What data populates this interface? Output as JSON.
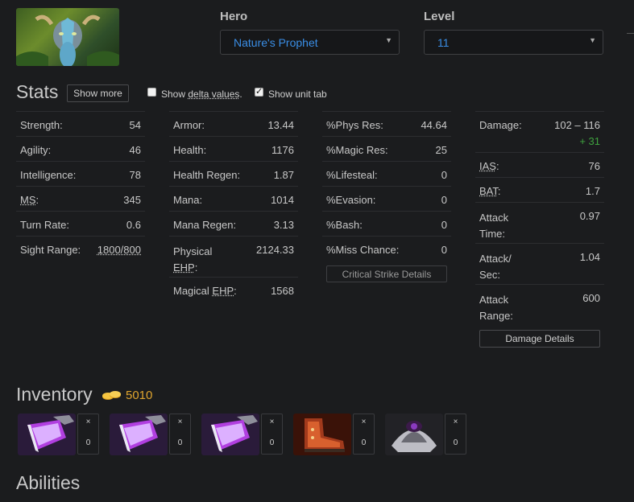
{
  "hero_label": "Hero",
  "hero_value": "Nature's Prophet",
  "level_label": "Level",
  "level_value": "11",
  "stats_title": "Stats",
  "show_more": "Show more",
  "delta_pre": "Show ",
  "delta_link": "delta values",
  "delta_post": ".",
  "unit_tab": "Show unit tab",
  "col1": [
    {
      "k": "Strength:",
      "v": "54"
    },
    {
      "k": "Agility:",
      "v": "46"
    },
    {
      "k": "Intelligence:",
      "v": "78"
    },
    {
      "k": "MS",
      "k2": ":",
      "v": "345"
    },
    {
      "k": "Turn Rate:",
      "v": "0.6"
    },
    {
      "k": "Sight Range:",
      "v": "1800/800"
    }
  ],
  "col2": [
    {
      "k": "Armor:",
      "v": "13.44"
    },
    {
      "k": "Health:",
      "v": "1176"
    },
    {
      "k": "Health Regen:",
      "v": "1.87"
    },
    {
      "k": "Mana:",
      "v": "1014"
    },
    {
      "k": "Mana Regen:",
      "v": "3.13"
    },
    {
      "k1": "Physical",
      "k2": "EHP",
      "k3": ":",
      "v": "2124.33"
    },
    {
      "k1": "Magical ",
      "k2": "EHP",
      "k3": ":",
      "v": "1568"
    }
  ],
  "col3": [
    {
      "k": "%Phys Res:",
      "v": "44.64"
    },
    {
      "k": "%Magic Res:",
      "v": "25"
    },
    {
      "k": "%Lifesteal:",
      "v": "0"
    },
    {
      "k": "%Evasion:",
      "v": "0"
    },
    {
      "k": "%Bash:",
      "v": "0"
    },
    {
      "k": "%Miss Chance:",
      "v": "0"
    }
  ],
  "crit_button": "Critical Strike Details",
  "col4": {
    "damage_k": "Damage:",
    "damage_v": "102 – 116",
    "damage_bonus": "+ 31",
    "ias_k": "IAS",
    "ias_colon": ":",
    "ias_v": "76",
    "bat_k": "BAT",
    "bat_colon": ":",
    "bat_v": "1.7",
    "at_k1": "Attack",
    "at_k2": "Time:",
    "at_v": "0.97",
    "as_k1": "Attack/",
    "as_k2": "Sec:",
    "as_v": "1.04",
    "ar_k1": "Attack",
    "ar_k2": "Range:",
    "ar_v": "600"
  },
  "damage_button": "Damage Details",
  "inventory_title": "Inventory",
  "gold": "5010",
  "slots": [
    {
      "icon": "dagon-icon",
      "x": "×",
      "n": "0"
    },
    {
      "icon": "dagon-icon",
      "x": "×",
      "n": "0"
    },
    {
      "icon": "dagon-icon",
      "x": "×",
      "n": "0"
    },
    {
      "icon": "boots-icon",
      "x": "×",
      "n": "0"
    },
    {
      "icon": "skull-armor-icon",
      "x": "×",
      "n": "0"
    }
  ],
  "abilities_title": "Abilities"
}
